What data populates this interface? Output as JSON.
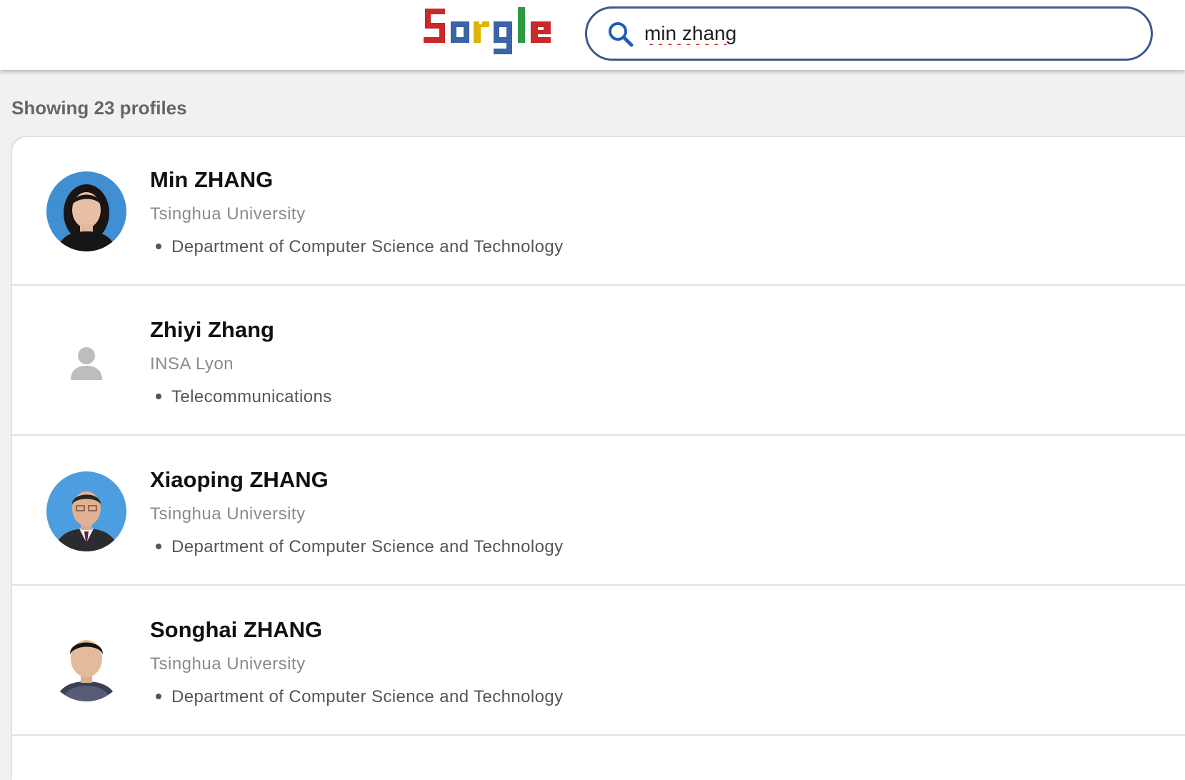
{
  "header": {
    "logo_text": "Sorgle",
    "search": {
      "value": "min zhang",
      "icon": "search-icon"
    }
  },
  "results": {
    "count_text": "Showing 23 profiles",
    "profiles": [
      {
        "name": "Min ZHANG",
        "organization": "Tsinghua University",
        "department": "Department of Computer Science and Technology",
        "avatar": "photo"
      },
      {
        "name": "Zhiyi Zhang",
        "organization": "INSA Lyon",
        "department": "Telecommunications",
        "avatar": "person-placeholder-icon"
      },
      {
        "name": "Xiaoping ZHANG",
        "organization": "Tsinghua University",
        "department": "Department of Computer Science and Technology",
        "avatar": "photo"
      },
      {
        "name": "Songhai ZHANG",
        "organization": "Tsinghua University",
        "department": "Department of Computer Science and Technology",
        "avatar": "photo"
      }
    ]
  },
  "colors": {
    "logo_red": "#c8292b",
    "logo_blue": "#3a63a8",
    "logo_green": "#2f9a43",
    "logo_yellow": "#e0b300",
    "search_border": "#3a5c8c",
    "search_icon": "#1f5fb3",
    "page_background": "#f2f1ef"
  }
}
